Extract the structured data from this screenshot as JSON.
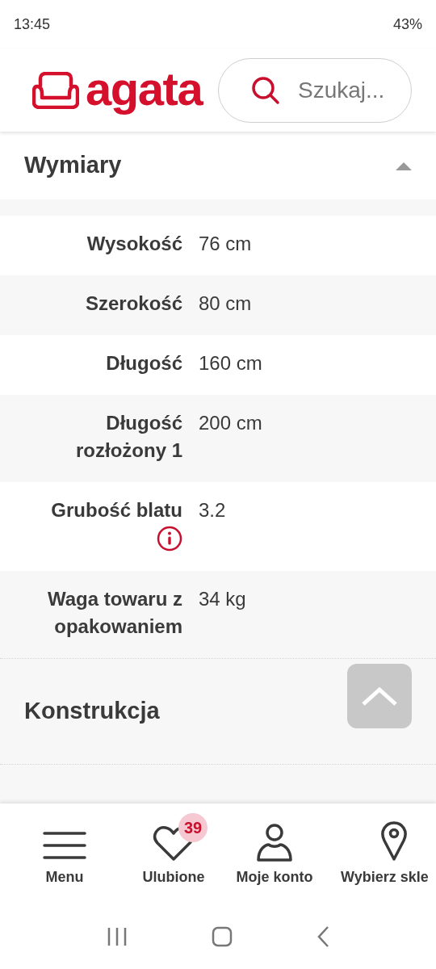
{
  "status_bar": {
    "time": "13:45",
    "battery": "43%"
  },
  "header": {
    "logo": "agata",
    "search": {
      "placeholder": "Szukaj..."
    }
  },
  "section": {
    "title": "Wymiary",
    "expanded": true
  },
  "rows": [
    {
      "label": "Wysokość",
      "value": "76 cm",
      "info": false
    },
    {
      "label": "Szerokość",
      "value": "80 cm",
      "info": false
    },
    {
      "label": "Długość",
      "value": "160 cm",
      "info": false
    },
    {
      "label": "Długość rozłożony 1",
      "value": "200 cm",
      "info": false
    },
    {
      "label": "Grubość blatu",
      "value": "3.2",
      "info": true
    },
    {
      "label": "Waga towaru z opakowaniem",
      "value": "34 kg",
      "info": false
    }
  ],
  "next_section": {
    "title": "Konstrukcja"
  },
  "bottom_nav": [
    {
      "kind": "menu",
      "label": "Menu"
    },
    {
      "kind": "heart",
      "label": "Ulubione",
      "badge": "39"
    },
    {
      "kind": "user",
      "label": "Moje konto"
    },
    {
      "kind": "pin",
      "label": "Wybierz skle"
    }
  ]
}
